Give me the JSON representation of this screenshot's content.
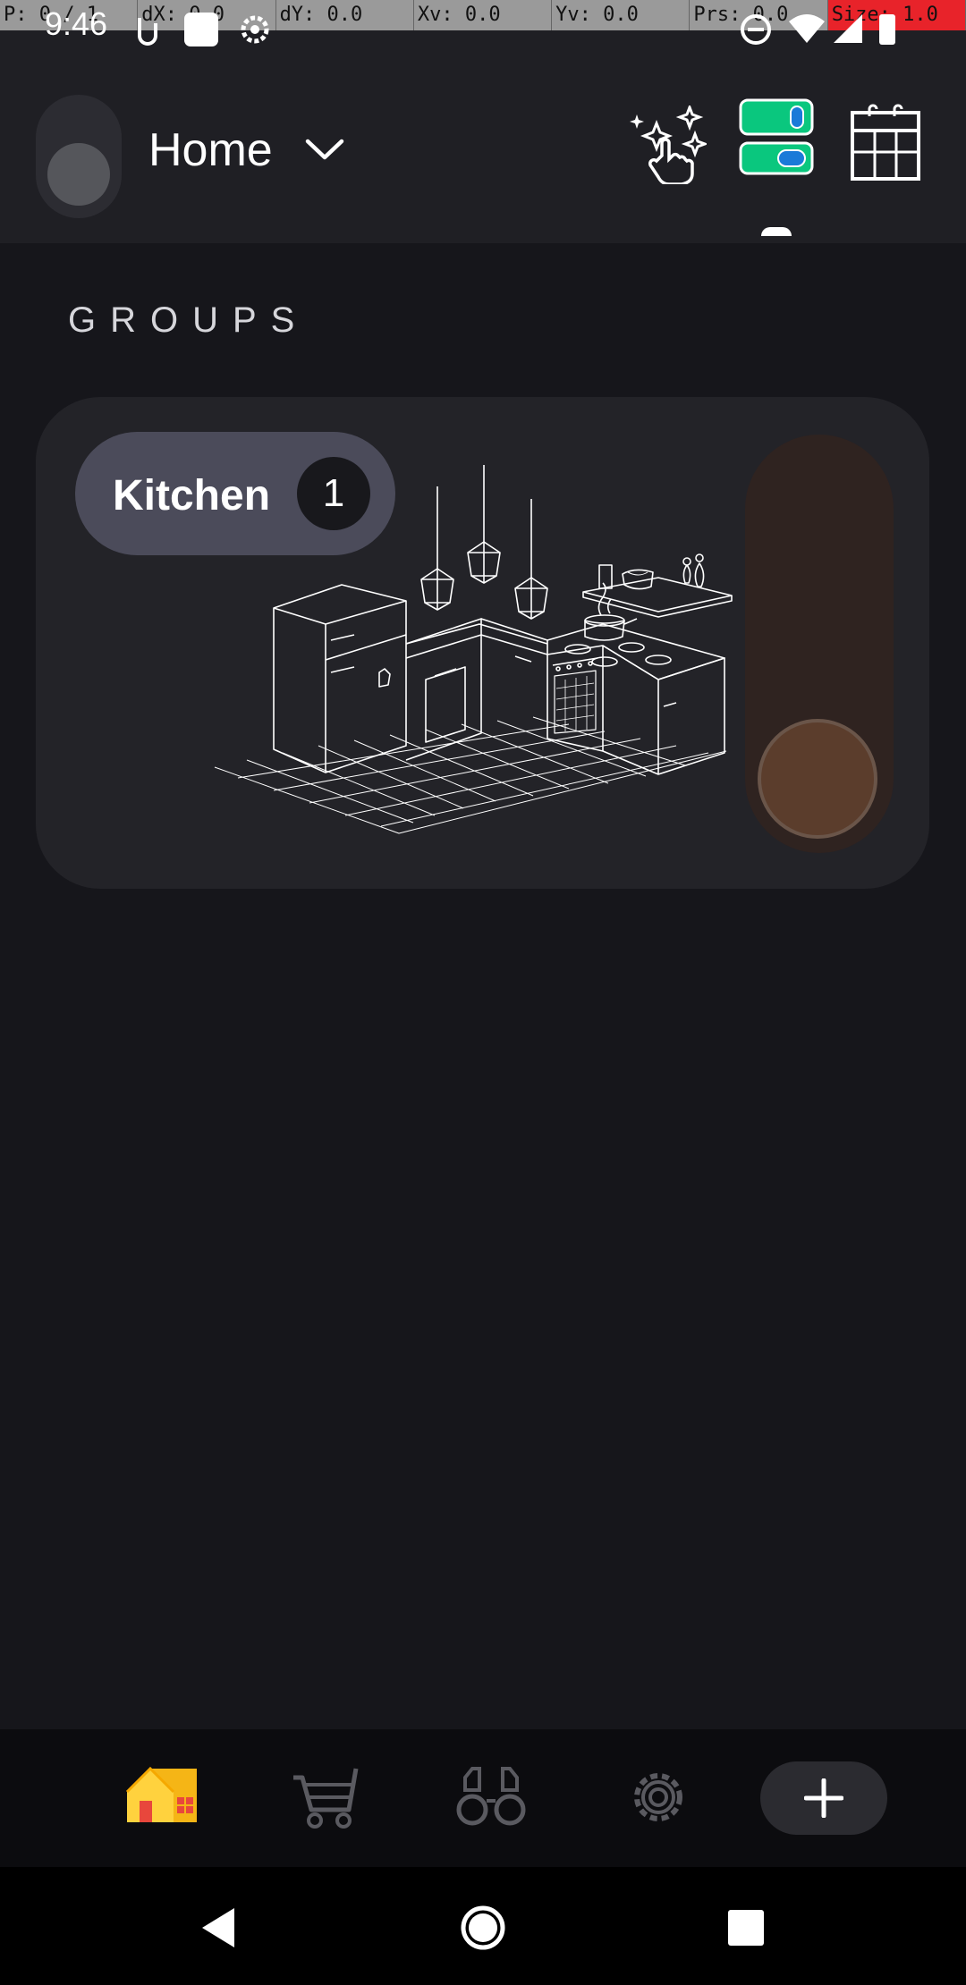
{
  "debug_bar": {
    "cells": [
      "P: 0 / 1",
      "dX: 0.0",
      "dY: 0.0",
      "Xv: 0.0",
      "Yv: 0.0",
      "Prs: 0.0",
      "Size: 1.0"
    ]
  },
  "status_bar": {
    "time": "9:46"
  },
  "header": {
    "home_label": "Home",
    "icons": [
      "magic-scene-icon",
      "device-list-icon",
      "calendar-icon"
    ]
  },
  "groups": {
    "section_title": "GROUPS",
    "items": [
      {
        "name": "Kitchen",
        "count": "1",
        "slider_color": "#5b3d2c"
      }
    ]
  },
  "bottom_nav": {
    "items": [
      "home-icon",
      "cart-icon",
      "binoculars-icon",
      "settings-icon",
      "add-icon"
    ]
  },
  "colors": {
    "background": "#16161b",
    "header": "#1f1f24",
    "card": "#232328",
    "chip": "#4b4b5a",
    "slider_track": "#2f2320",
    "slider_knob": "#5b3d2c"
  }
}
